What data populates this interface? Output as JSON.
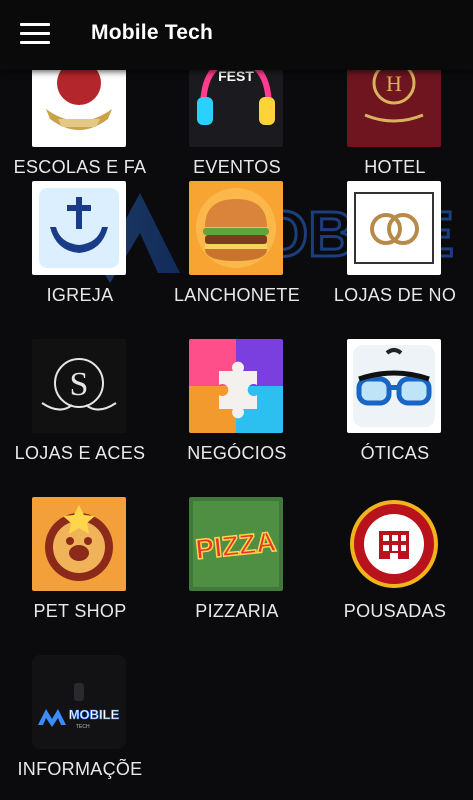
{
  "appbar": {
    "title": "Mobile Tech",
    "menu_icon": "hamburger-menu-icon"
  },
  "watermark": {
    "text": "MOBILE"
  },
  "grid": {
    "items": [
      {
        "label": "ESCOLAS E FA",
        "icon": "crest-icon"
      },
      {
        "label": "EVENTOS",
        "icon": "headphones-fest-icon"
      },
      {
        "label": "HOTEL",
        "icon": "hotel-crest-icon"
      },
      {
        "label": "IGREJA",
        "icon": "cross-hands-icon"
      },
      {
        "label": "LANCHONETE",
        "icon": "burger-icon"
      },
      {
        "label": "LOJAS DE NO",
        "icon": "rings-icon"
      },
      {
        "label": "LOJAS E ACES",
        "icon": "monogram-s-icon"
      },
      {
        "label": "NEGÓCIOS",
        "icon": "puzzle-icon"
      },
      {
        "label": "ÓTICAS",
        "icon": "glasses-icon"
      },
      {
        "label": "PET SHOP",
        "icon": "pet-badge-icon"
      },
      {
        "label": "PIZZARIA",
        "icon": "pizza-icon"
      },
      {
        "label": "POUSADAS",
        "icon": "building-icon"
      },
      {
        "label": "INFORMAÇÕE",
        "icon": "mobile-tech-logo-icon",
        "logo_text": "MOBILE",
        "logo_sub": "TECH"
      }
    ]
  }
}
